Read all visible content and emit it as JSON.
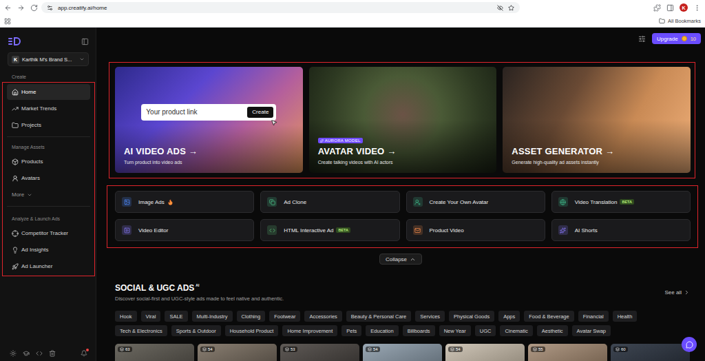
{
  "browser": {
    "url": "app.creatify.ai/home",
    "bookmarks": "All Bookmarks",
    "profile": "K"
  },
  "sidebar": {
    "workspace": {
      "initial": "K",
      "name": "Karthik M's Brand S..."
    },
    "highlighted": true,
    "notifications_unread": true,
    "sections": [
      {
        "label": "Create",
        "items": [
          {
            "label": "Home",
            "kind": "link",
            "selected": true
          },
          {
            "label": "Market Trends",
            "kind": "link",
            "selected": false
          },
          {
            "label": "Projects",
            "kind": "link",
            "selected": false
          }
        ]
      },
      {
        "label": "Manage Assets",
        "items": [
          {
            "label": "Products",
            "kind": "link",
            "selected": false
          },
          {
            "label": "Avatars",
            "kind": "link",
            "selected": false
          },
          {
            "label": "More",
            "kind": "more",
            "selected": false
          }
        ]
      },
      {
        "label": "Analyze & Launch Ads",
        "items": [
          {
            "label": "Competitor Tracker",
            "kind": "link",
            "selected": false
          },
          {
            "label": "Ad Insights",
            "kind": "link",
            "selected": false
          },
          {
            "label": "Ad Launcher",
            "kind": "link",
            "selected": false
          }
        ]
      }
    ]
  },
  "header": {
    "upgrade": "Upgrade",
    "credits": "10"
  },
  "hero": {
    "highlighted": true,
    "cards": [
      {
        "kind": "input",
        "title": "AI VIDEO ADS →",
        "subtitle": "Turn product into video ads",
        "placeholder": "Your product link",
        "button": "Create"
      },
      {
        "kind": "badge",
        "title": "AVATAR VIDEO →",
        "subtitle": "Create talking videos with AI actors",
        "badge": "AURORA MODEL"
      },
      {
        "kind": "plain",
        "title": "ASSET GENERATOR →",
        "subtitle": "Generate high-quality ad assets instantly"
      }
    ]
  },
  "tools": {
    "highlighted": true,
    "items": [
      {
        "label": "Image Ads",
        "hot": true,
        "color": "#4f8cff"
      },
      {
        "label": "Ad Clone",
        "hot": false,
        "color": "#4cc38a"
      },
      {
        "label": "Create Your Own Avatar",
        "hot": false,
        "color": "#3fb98a"
      },
      {
        "label": "Video Translation",
        "hot": false,
        "badge": "BETA",
        "color": "#3fb98a"
      },
      {
        "label": "Video Editor",
        "hot": false,
        "color": "#8b7cff"
      },
      {
        "label": "HTML Interactive Ad",
        "hot": false,
        "badge": "BETA",
        "color": "#5fc37a"
      },
      {
        "label": "Product Video",
        "hot": false,
        "color": "#f08a4b"
      },
      {
        "label": "AI Shorts",
        "hot": false,
        "color": "#8b7cff"
      }
    ]
  },
  "collapse": "Collapse",
  "social": {
    "title": "SOCIAL & UGC ADS",
    "title_badge": "AI",
    "subtitle": "Discover social-first and UGC-style ads made to feel native and authentic.",
    "see_all": "See all",
    "tag_rows": [
      [
        "Hook",
        "Viral",
        "SALE",
        "Multi-Industry",
        "Clothing",
        "Footwear",
        "Accessories",
        "Beauty & Personal Care",
        "Services",
        "Physical Goods",
        "Apps",
        "Food & Beverage",
        "Financial",
        "Health"
      ],
      [
        "Tech & Electronics",
        "Sports & Outdoor",
        "Household Product",
        "Home Improvement",
        "Pets",
        "Education",
        "Billboards",
        "New Year",
        "UGC",
        "Cinematic",
        "Aesthetic",
        "Avatar Swap"
      ]
    ],
    "thumbnails": [
      {
        "count": "63"
      },
      {
        "count": "54"
      },
      {
        "count": "53"
      },
      {
        "count": "54"
      },
      {
        "count": "54"
      },
      {
        "count": "55"
      },
      {
        "count": "60"
      }
    ]
  }
}
